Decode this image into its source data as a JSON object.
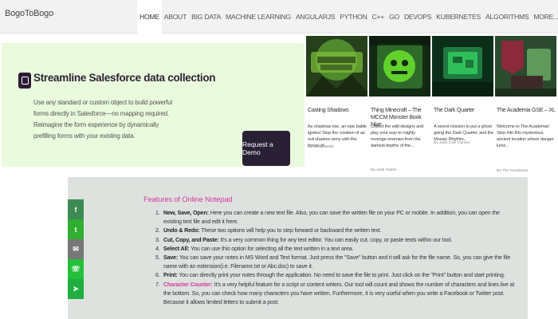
{
  "header": {
    "brand": "BogoToBogo",
    "nav": [
      "HOME",
      "ABOUT",
      "BIG DATA",
      "MACHINE LEARNING",
      "ANGULARJS",
      "PYTHON",
      "C++",
      "GO",
      "DEVOPS",
      "KUBERNETES",
      "ALGORITHMS",
      "MORE..."
    ]
  },
  "ad": {
    "title": "Streamline Salesforce data collection",
    "text": "Use any standard or custom object to build powerful forms directly in Salesforce—no mapping required. Reimagine the form experience by dynamically prefilling forms with your existing data.",
    "button": "Request a Demo"
  },
  "cards": [
    {
      "title": "Casting Shadows",
      "desc": "As shadows rise, an epic battle ignites! Stop the creation of an evil shadow army with the forces of...",
      "by": "By Lucky Battle",
      "colors": [
        "#3a5d2a",
        "#8fcf3a"
      ]
    },
    {
      "title": "Thing Minecraft – The MCCM Monster Book Nine",
      "desc": "Collect the wild designs and play your way to mighty revenge enemies from the darkest depths of the...",
      "by": "By Jada Stahle",
      "colors": [
        "#1c3b20",
        "#5fd12c"
      ]
    },
    {
      "title": "The Dark Quarter",
      "desc": "A secret mission to put a ghost going the Dark Quarter, and the Mosaic Rhythm...",
      "by": "By Jada Cole Games",
      "colors": [
        "#0f3a22",
        "#2fae55"
      ]
    },
    {
      "title": "The Academia GSE – XL",
      "desc": "Welcome to The Academia! Step into this mysterious, ancient location where danger lurks...",
      "by": "By The Purplesaur",
      "colors": [
        "#4a2a3a",
        "#2f7a3d"
      ]
    }
  ],
  "content": {
    "title": "Features of Online Notepad",
    "items": [
      {
        "label": "New, Save, Open:",
        "text": " Here you can create a new text file. Also, you can save the written file on your PC or mobile. In addition, you can open the existing text file and edit it here.",
        "pink": false
      },
      {
        "label": "Undo & Redo:",
        "text": " These two options will help you to step forward or backward the written text.",
        "pink": false
      },
      {
        "label": "Cut, Copy, and Paste:",
        "text": " It's a very common thing for any text editor. You can easily cut, copy, or paste texts within our tool.",
        "pink": false
      },
      {
        "label": "Select All:",
        "text": " You can use this option for selecting all the text written in a text area.",
        "pink": false
      },
      {
        "label": "Save:",
        "text": " You can save your notes in MS Word and Text format. Just press the \"Save\" button and it will ask for the file name. So, you can give the file name with an extension(i.e. Filename.txt or Abc.doc) to save it.",
        "pink": false
      },
      {
        "label": "Print:",
        "text": " You can directly print your notes through the application. No need to save the file to print. Just click on the \"Print\" button and start printing.",
        "pink": false
      },
      {
        "label": "Character Counter:",
        "text": " It's a very helpful feature for a script or content writers. Our tool will count and shows the number of characters and lines live at the bottom. So, you can check how many characters you have written. Furthermore, it is very useful when you write a Facebook or Twitter post. Because it allows limited letters to submit a post.",
        "pink": true
      }
    ]
  },
  "social": [
    {
      "icon": "facebook-icon",
      "glyph": "f",
      "color": "#3b8b52"
    },
    {
      "icon": "twitter-icon",
      "glyph": "t",
      "color": "#2fae2f"
    },
    {
      "icon": "email-icon",
      "glyph": "✉",
      "color": "#777777"
    },
    {
      "icon": "whatsapp-icon",
      "glyph": "☏",
      "color": "#25c03a"
    },
    {
      "icon": "telegram-icon",
      "glyph": "➤",
      "color": "#1fae3f"
    }
  ]
}
